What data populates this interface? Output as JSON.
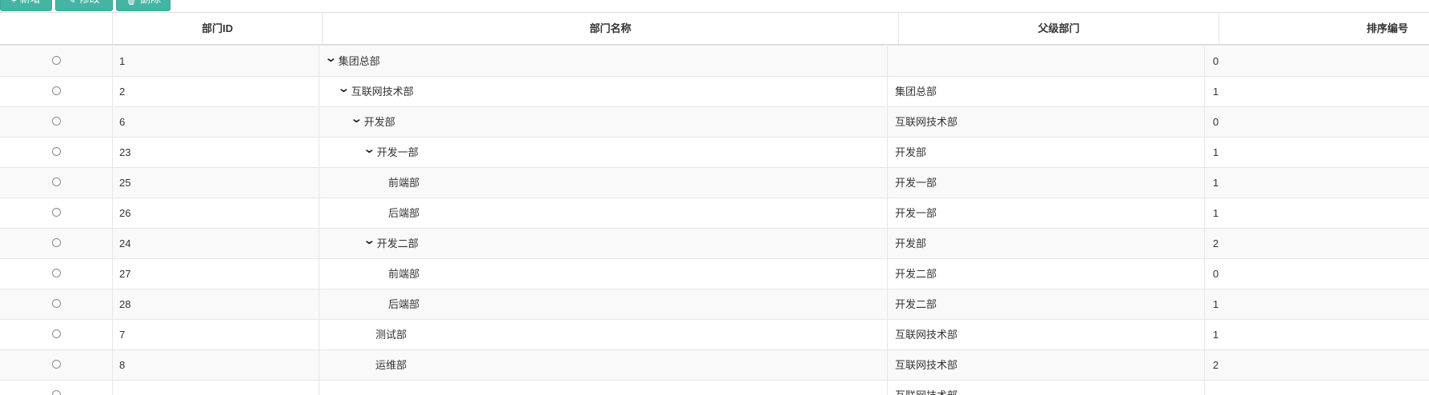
{
  "toolbar": {
    "add_icon": "+",
    "add_label": "新增",
    "edit_icon": "✎",
    "edit_label": "修改",
    "delete_icon": "🗑",
    "delete_label": "删除",
    "button_color": "#45b5a3"
  },
  "table": {
    "columns": {
      "select": "",
      "id": "部门ID",
      "name": "部门名称",
      "parent": "父级部门",
      "sort": "排序编号"
    },
    "rows": [
      {
        "id": "1",
        "name": "集团总部",
        "parent": "",
        "sort": "0",
        "level": 0,
        "expandable": true
      },
      {
        "id": "2",
        "name": "互联网技术部",
        "parent": "集团总部",
        "sort": "1",
        "level": 1,
        "expandable": true
      },
      {
        "id": "6",
        "name": "开发部",
        "parent": "互联网技术部",
        "sort": "0",
        "level": 2,
        "expandable": true
      },
      {
        "id": "23",
        "name": "开发一部",
        "parent": "开发部",
        "sort": "1",
        "level": 3,
        "expandable": true
      },
      {
        "id": "25",
        "name": "前端部",
        "parent": "开发一部",
        "sort": "1",
        "level": 4,
        "expandable": false
      },
      {
        "id": "26",
        "name": "后端部",
        "parent": "开发一部",
        "sort": "1",
        "level": 4,
        "expandable": false
      },
      {
        "id": "24",
        "name": "开发二部",
        "parent": "开发部",
        "sort": "2",
        "level": 3,
        "expandable": true
      },
      {
        "id": "27",
        "name": "前端部",
        "parent": "开发二部",
        "sort": "0",
        "level": 4,
        "expandable": false
      },
      {
        "id": "28",
        "name": "后端部",
        "parent": "开发二部",
        "sort": "1",
        "level": 4,
        "expandable": false
      },
      {
        "id": "7",
        "name": "测试部",
        "parent": "互联网技术部",
        "sort": "1",
        "level": 3,
        "expandable": false
      },
      {
        "id": "8",
        "name": "运维部",
        "parent": "互联网技术部",
        "sort": "2",
        "level": 3,
        "expandable": false
      },
      {
        "id": "",
        "name": "",
        "parent": "互联网技术部",
        "sort": "",
        "level": 3,
        "expandable": false
      }
    ]
  },
  "icons": {
    "expand": "chevron-down-icon",
    "select": "radio-icon"
  }
}
